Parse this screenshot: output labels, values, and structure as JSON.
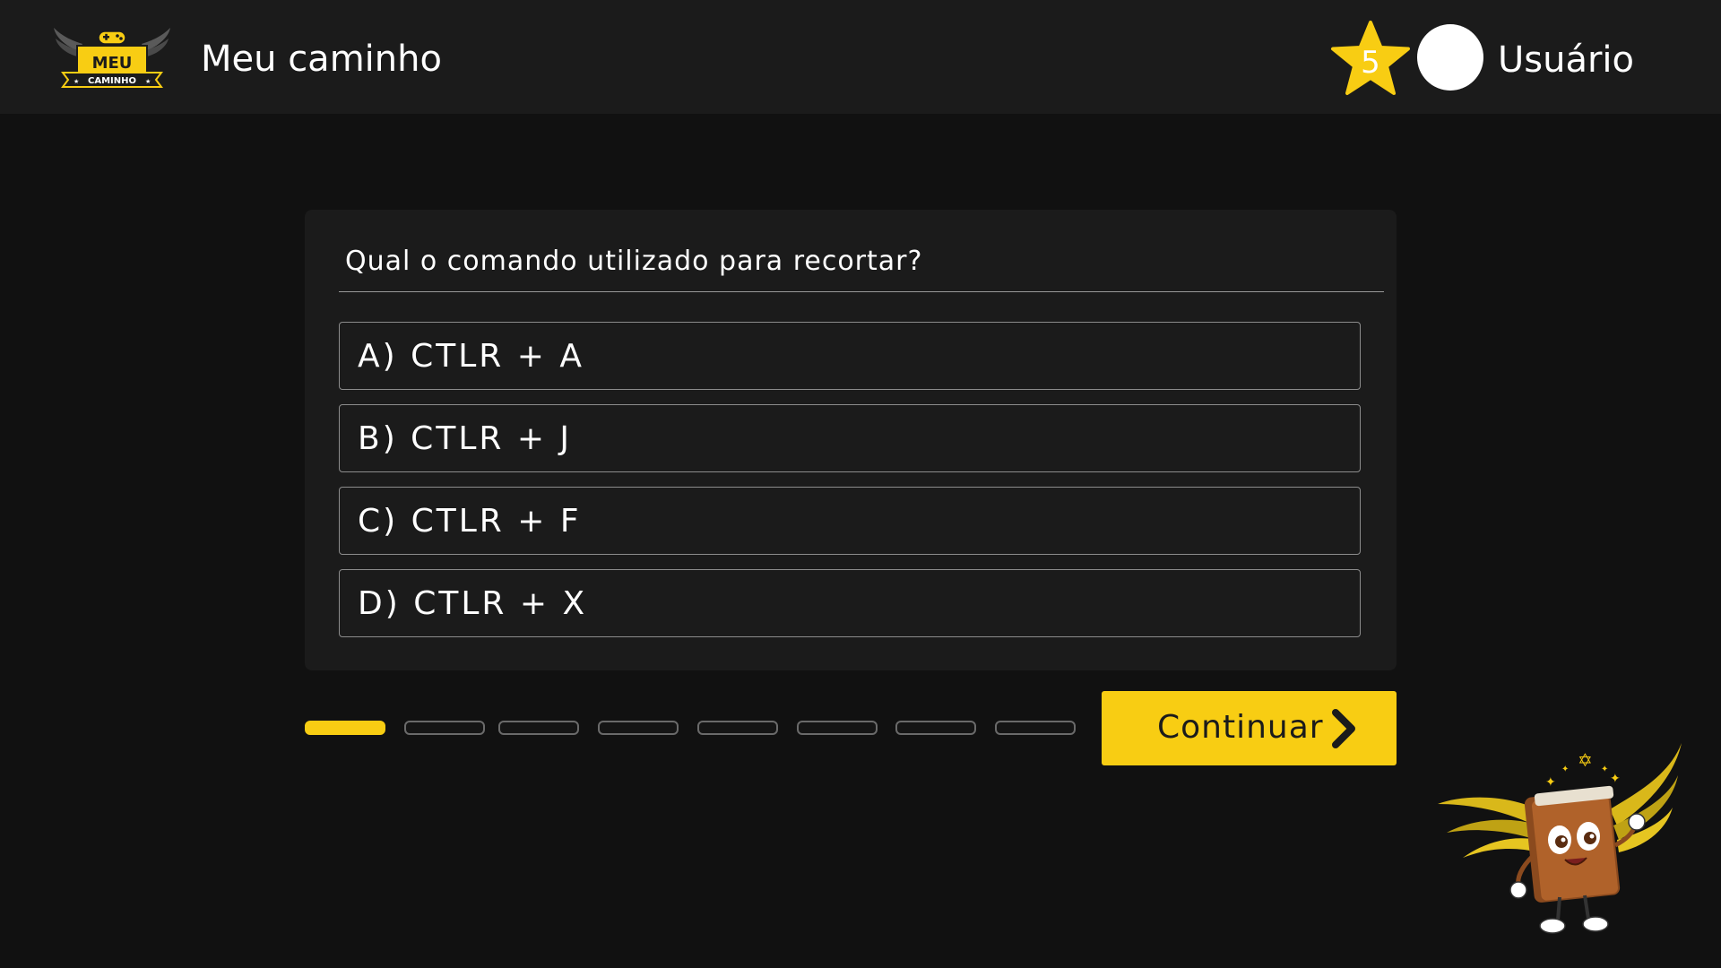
{
  "header": {
    "logo": {
      "line1": "MEU",
      "line2": "CAMINHO"
    },
    "app_title": "Meu caminho",
    "points": "5",
    "username": "Usuário"
  },
  "quiz": {
    "question": "Qual o comando utilizado para recortar?",
    "options": [
      {
        "label": "A) CTLR + A"
      },
      {
        "label": "B) CTLR + J"
      },
      {
        "label": "C) CTLR + F"
      },
      {
        "label": "D) CTLR + X"
      }
    ]
  },
  "progress": {
    "total_steps": 8,
    "completed_steps": 1
  },
  "actions": {
    "continue_label": "Continuar"
  },
  "colors": {
    "accent": "#f8cd13",
    "header_bg": "#1b1b1b",
    "page_bg": "#111111",
    "card_bg": "#1b1b1b"
  }
}
